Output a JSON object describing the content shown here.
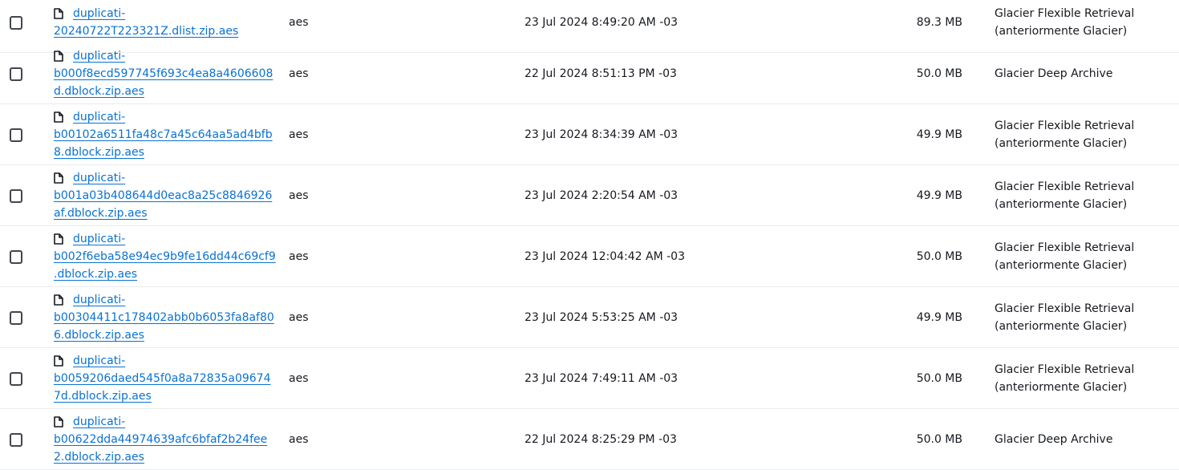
{
  "rows": [
    {
      "name_line1": "duplicati-",
      "name_rest": "20240722T223321Z.dlist.zip.aes",
      "type": "aes",
      "last_modified": "23 Jul 2024 8:49:20 AM -03",
      "size": "89.3 MB",
      "storage_class": "Glacier Flexible Retrieval\n(anteriormente Glacier)"
    },
    {
      "name_line1": "duplicati-",
      "name_rest": "b000f8ecd597745f693c4ea8a4606608\nd.dblock.zip.aes",
      "type": "aes",
      "last_modified": "22 Jul 2024 8:51:13 PM -03",
      "size": "50.0 MB",
      "storage_class": "Glacier Deep Archive"
    },
    {
      "name_line1": "duplicati-",
      "name_rest": "b00102a6511fa48c7a45c64aa5ad4bfb\n8.dblock.zip.aes",
      "type": "aes",
      "last_modified": "23 Jul 2024 8:34:39 AM -03",
      "size": "49.9 MB",
      "storage_class": "Glacier Flexible Retrieval\n(anteriormente Glacier)"
    },
    {
      "name_line1": "duplicati-",
      "name_rest": "b001a03b408644d0eac8a25c8846926\naf.dblock.zip.aes",
      "type": "aes",
      "last_modified": "23 Jul 2024 2:20:54 AM -03",
      "size": "49.9 MB",
      "storage_class": "Glacier Flexible Retrieval\n(anteriormente Glacier)"
    },
    {
      "name_line1": "duplicati-",
      "name_rest": "b002f6eba58e94ec9b9fe16dd44c69cf9\n.dblock.zip.aes",
      "type": "aes",
      "last_modified": "23 Jul 2024 12:04:42 AM -03",
      "size": "50.0 MB",
      "storage_class": "Glacier Flexible Retrieval\n(anteriormente Glacier)"
    },
    {
      "name_line1": "duplicati-",
      "name_rest": "b00304411c178402abb0b6053fa8af80\n6.dblock.zip.aes",
      "type": "aes",
      "last_modified": "23 Jul 2024 5:53:25 AM -03",
      "size": "49.9 MB",
      "storage_class": "Glacier Flexible Retrieval\n(anteriormente Glacier)"
    },
    {
      "name_line1": "duplicati-",
      "name_rest": "b0059206daed545f0a8a72835a09674\n7d.dblock.zip.aes",
      "type": "aes",
      "last_modified": "23 Jul 2024 7:49:11 AM -03",
      "size": "50.0 MB",
      "storage_class": "Glacier Flexible Retrieval\n(anteriormente Glacier)"
    },
    {
      "name_line1": "duplicati-",
      "name_rest": "b00622dda44974639afc6bfaf2b24fee\n2.dblock.zip.aes",
      "type": "aes",
      "last_modified": "22 Jul 2024 8:25:29 PM -03",
      "size": "50.0 MB",
      "storage_class": "Glacier Deep Archive"
    }
  ],
  "icons": {
    "file": "file-icon"
  },
  "colors": {
    "link": "#0972d3",
    "text": "#16191f",
    "divider": "#e9ebed"
  }
}
